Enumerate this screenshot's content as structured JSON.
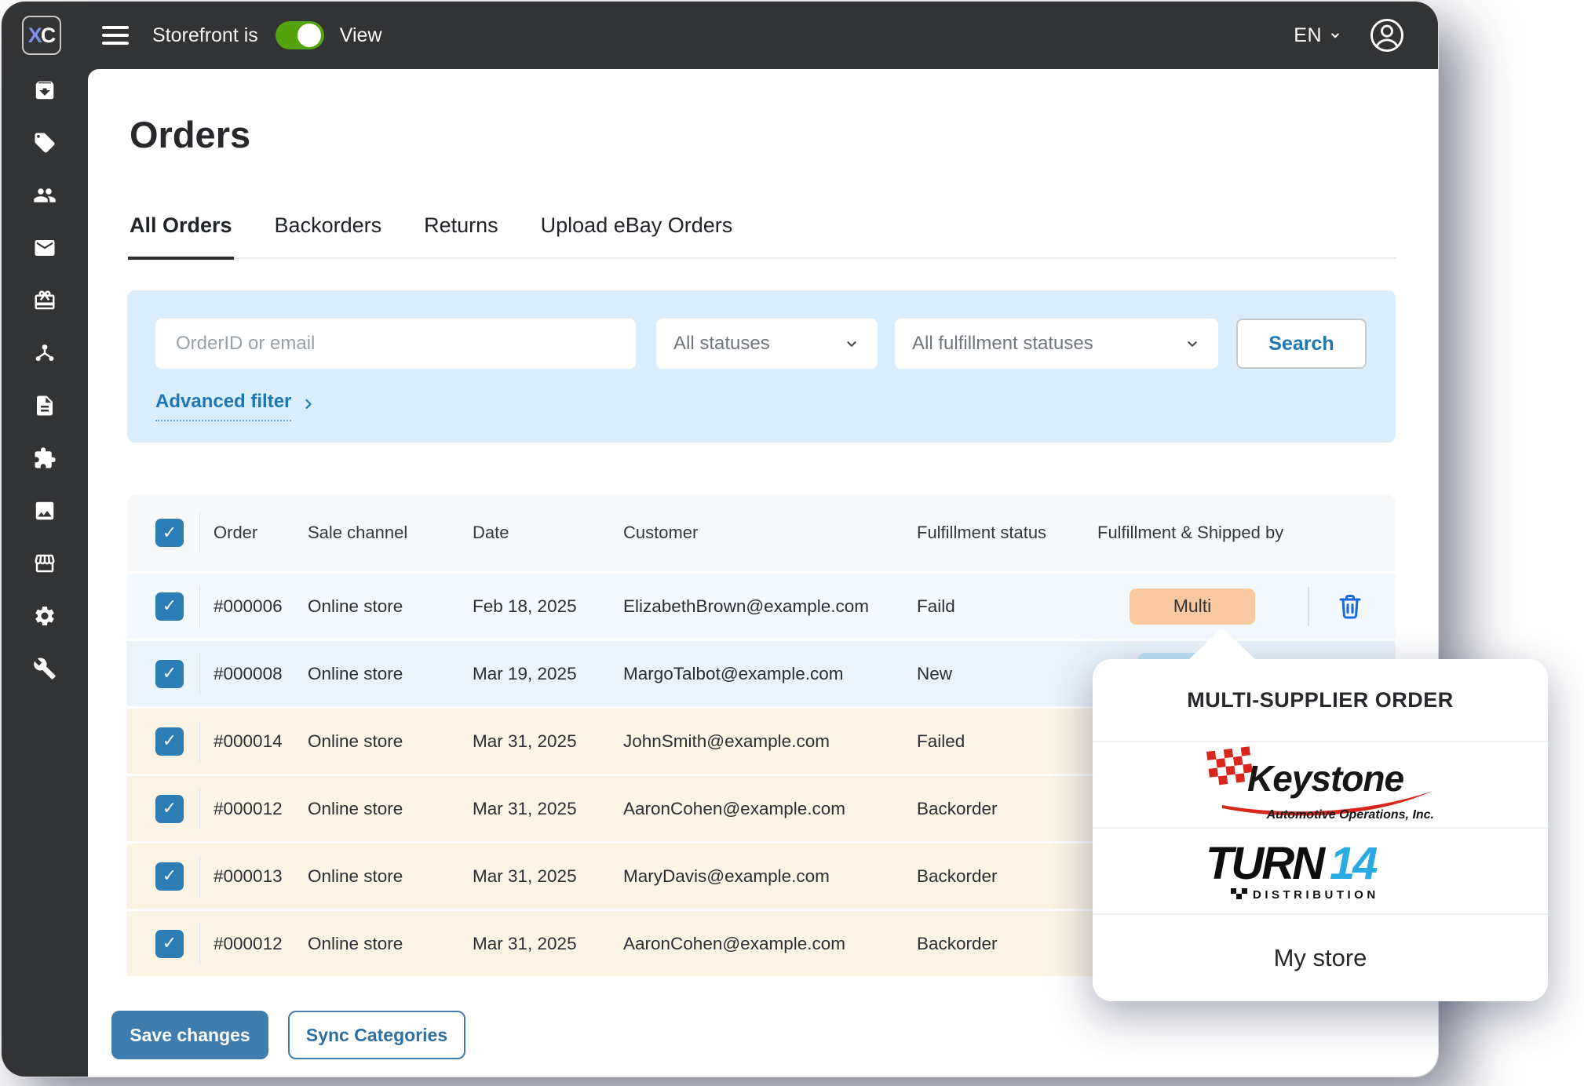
{
  "topbar": {
    "logo_x": "X",
    "logo_c": "C",
    "storefront_label": "Storefront is",
    "storefront_toggle_on": true,
    "view_label": "View",
    "language": "EN"
  },
  "sidebar": {
    "icons": [
      "orders-archive",
      "product-tag",
      "customers",
      "messages",
      "gift-certificates",
      "integrations-hub",
      "pages",
      "addons-puzzle",
      "media-images",
      "storefront",
      "settings-gear",
      "tools-wrench"
    ]
  },
  "page": {
    "title": "Orders"
  },
  "tabs": [
    {
      "label": "All Orders",
      "active": true
    },
    {
      "label": "Backorders",
      "active": false
    },
    {
      "label": "Returns",
      "active": false
    },
    {
      "label": "Upload eBay Orders",
      "active": false
    }
  ],
  "filters": {
    "search_placeholder": "OrderID or email",
    "status_select": "All statuses",
    "fulfillment_select": "All fulfillment statuses",
    "search_button": "Search",
    "advanced_filter_label": "Advanced filter"
  },
  "table": {
    "columns": [
      "Order",
      "Sale channel",
      "Date",
      "Customer",
      "Fulfillment status",
      "Fulfillment & Shipped by"
    ],
    "select_all_checked": true,
    "rows": [
      {
        "checked": true,
        "order": "#000006",
        "channel": "Online store",
        "date": "Feb 18, 2025",
        "customer": "ElizabethBrown@example.com",
        "status": "Faild",
        "badge": "Multi",
        "highlight": "blue"
      },
      {
        "checked": true,
        "order": "#000008",
        "channel": "Online store",
        "date": "Mar 19, 2025",
        "customer": "MargoTalbot@example.com",
        "status": "New",
        "highlight": "blue",
        "badge_peek": true
      },
      {
        "checked": true,
        "order": "#000014",
        "channel": "Online store",
        "date": "Mar 31, 2025",
        "customer": "JohnSmith@example.com",
        "status": "Failed",
        "highlight": "cream"
      },
      {
        "checked": true,
        "order": "#000012",
        "channel": "Online store",
        "date": "Mar 31, 2025",
        "customer": "AaronCohen@example.com",
        "status": "Backorder",
        "highlight": "cream"
      },
      {
        "checked": true,
        "order": "#000013",
        "channel": "Online store",
        "date": "Mar 31, 2025",
        "customer": "MaryDavis@example.com",
        "status": "Backorder",
        "highlight": "cream"
      },
      {
        "checked": true,
        "order": "#000012",
        "channel": "Online store",
        "date": "Mar 31, 2025",
        "customer": "AaronCohen@example.com",
        "status": "Backorder",
        "highlight": "cream"
      }
    ]
  },
  "actions": {
    "save_button": "Save changes",
    "sync_button": "Sync Categories"
  },
  "popup": {
    "title": "MULTI-SUPPLIER ORDER",
    "keystone": {
      "name": "Keystone",
      "subtitle": "Automotive Operations, Inc."
    },
    "turn14": {
      "name": "TURN",
      "number": "14",
      "subtitle": "DISTRIBUTION"
    },
    "my_store_label": "My store"
  },
  "colors": {
    "frame_dark": "#323335",
    "accent_blue": "#1D76B5",
    "save_blue": "#3E7DAD",
    "toggle_green": "#55A30F",
    "badge_peach": "#F8C9A1",
    "trash_blue": "#1667E0",
    "row_blue": "#F3F9FE",
    "row_blue_2": "#EAF4FC",
    "row_cream": "#FBF4E2",
    "filter_bg": "#D9EDFC",
    "checkbox_blue": "#2C7DB5",
    "turn14_cyan": "#29ABE2",
    "keystone_red": "#D8261C",
    "logo_x_blue": "#7D90E6"
  }
}
